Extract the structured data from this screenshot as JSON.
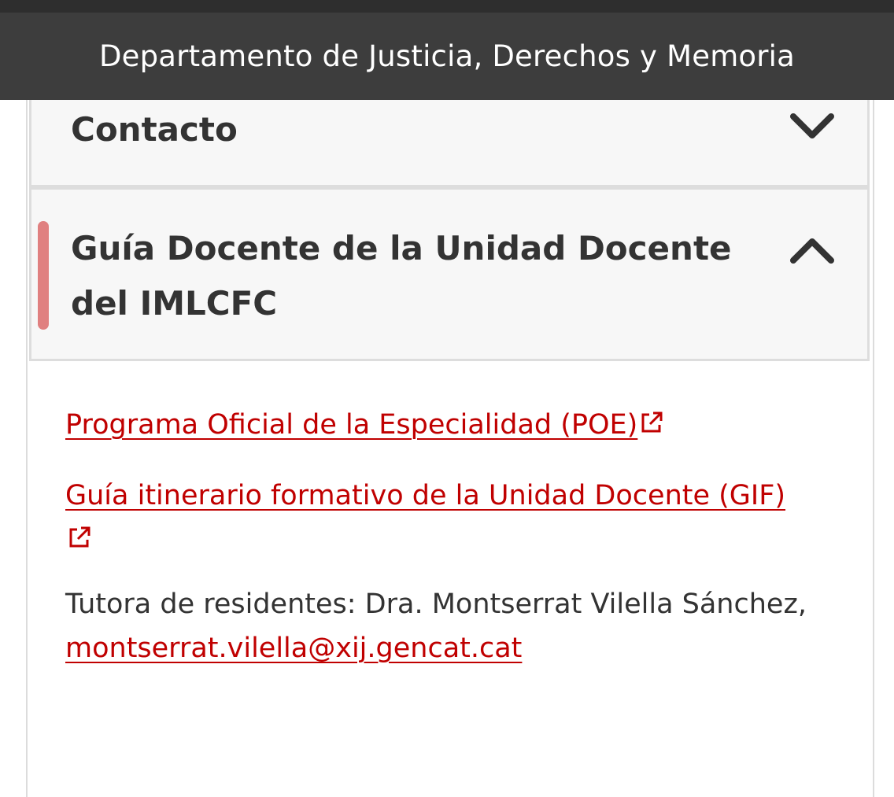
{
  "header": {
    "title": "Departamento de Justicia, Derechos y Memoria"
  },
  "accordion": {
    "contacto_title": "Contacto",
    "guia_title": "Guía Docente de la Unidad Docente del IMLCFC"
  },
  "content": {
    "link_poe": "Programa Oficial de la Especialidad (POE)",
    "link_gif": "Guía itinerario formativo de la Unidad Docente (GIF)",
    "tutor_text": "Tutora de residentes: Dra. Montserrat Vilella Sánchez,",
    "tutor_email": "montserrat.vilella@xij.gencat.cat"
  },
  "colors": {
    "header_bg": "#3d3d3d",
    "link": "#c00000",
    "active_indicator": "#e08080"
  },
  "icons": {
    "expand": "chevron-down-icon",
    "collapse": "chevron-up-icon",
    "external": "external-link-icon"
  }
}
